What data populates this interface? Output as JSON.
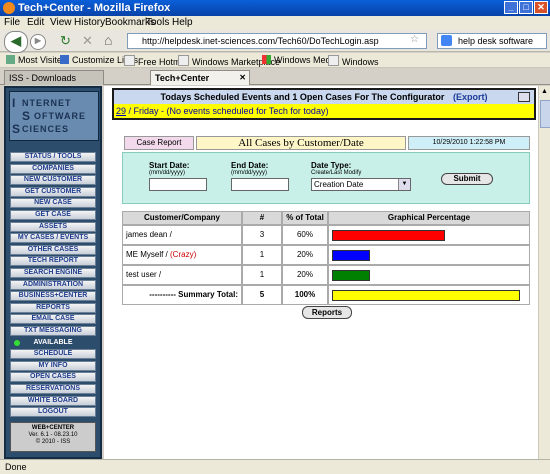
{
  "window": {
    "title": "Tech+Center - Mozilla Firefox"
  },
  "menu": [
    "File",
    "Edit",
    "View",
    "History",
    "Bookmarks",
    "Tools",
    "Help"
  ],
  "nav": {
    "url": "http://helpdesk.inet-sciences.com/Tech60/DoTechLogin.asp",
    "search_value": "help desk software"
  },
  "bookmarks": [
    "Most Visited",
    "Customize Links",
    "Free Hotmail",
    "Windows Marketplace",
    "Windows Media",
    "Windows"
  ],
  "tabs": [
    {
      "label": "ISS - Downloads",
      "active": false
    },
    {
      "label": "Tech+Center",
      "active": true
    }
  ],
  "sidebar": {
    "logo": [
      "NTERNET",
      "OFTWARE",
      "CIENCES"
    ],
    "logo_initials": [
      "I",
      "S",
      "S"
    ],
    "items": [
      "STATUS / TOOLS",
      "COMPANIES",
      "NEW CUSTOMER",
      "GET CUSTOMER",
      "NEW CASE",
      "GET CASE",
      "ASSETS",
      "MY CASES / EVENTS",
      "OTHER CASES",
      "TECH REPORT",
      "SEARCH ENGINE",
      "ADMINISTRATION",
      "BUSINESS+CENTER",
      "REPORTS",
      "EMAIL CASE",
      "TXT MESSAGING",
      "AVAILABLE",
      "SCHEDULE",
      "MY INFO",
      "OPEN CASES",
      "RESERVATIONS",
      "WHITE BOARD",
      "LOGOUT"
    ],
    "highlighted_index": 16,
    "version_lines": [
      "WEB+CENTER",
      "Ver. 6.1 - 08.23.10",
      "© 2010 - ISS"
    ]
  },
  "events": {
    "title": "Todays Scheduled Events and  1  Open Cases For  The Configurator",
    "export_label": "(Export)",
    "day_link": "29",
    "line": " / Friday - (No events scheduled for Tech for today)"
  },
  "report": {
    "tab_label": "Case Report",
    "title": "All Cases by Customer/Date",
    "timestamp": "10/29/2010 1:22:58 PM",
    "start_label": "Start Date:",
    "start_hint": "(mm/dd/yyyy)",
    "end_label": "End Date:",
    "end_hint": "(mm/dd/yyyy)",
    "type_label": "Date Type:",
    "type_hint": "Create/Last Modify",
    "type_value": "Creation Date",
    "submit_label": "Submit",
    "columns": [
      "Customer/Company",
      "#",
      "% of Total",
      "Graphical Percentage"
    ],
    "rows": [
      {
        "name": "james dean /",
        "extra": "",
        "count": "3",
        "pct": "60%",
        "fraction": 0.6,
        "color": "#ff0000"
      },
      {
        "name": "ME Myself / ",
        "extra": "(Crazy)",
        "count": "1",
        "pct": "20%",
        "fraction": 0.2,
        "color": "#0000ff"
      },
      {
        "name": "test user /",
        "extra": "",
        "count": "1",
        "pct": "20%",
        "fraction": 0.2,
        "color": "#008000"
      }
    ],
    "summary": {
      "label": "---------- Summary Total:",
      "count": "5",
      "pct": "100%",
      "fraction": 1.0,
      "color": "#ffff00"
    },
    "reports_button": "Reports"
  },
  "status": {
    "text": "Done"
  },
  "colors": {
    "sidebar_bg": "#2d4d6d",
    "event_header": "#c9d8ef",
    "event_line": "#ffff00",
    "filter_bg": "#c8f0e8"
  }
}
